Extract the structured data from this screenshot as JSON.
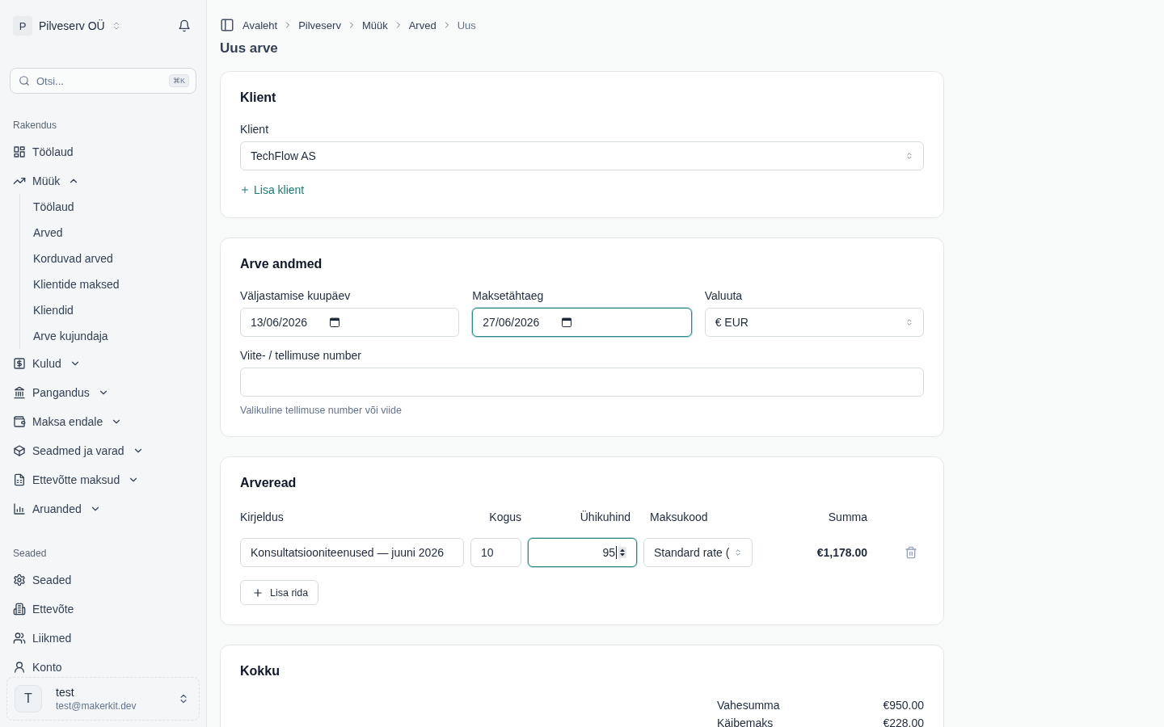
{
  "sidebar": {
    "org": {
      "initial": "P",
      "name": "Pilveserv OÜ"
    },
    "search": {
      "placeholder": "Otsi...",
      "shortcut": "⌘K"
    },
    "sections": [
      {
        "label": "Rakendus",
        "items": [
          {
            "label": "Töölaud",
            "kind": "link"
          },
          {
            "label": "Müük",
            "kind": "group",
            "expanded": true,
            "children": [
              {
                "label": "Töölaud"
              },
              {
                "label": "Arved"
              },
              {
                "label": "Korduvad arved"
              },
              {
                "label": "Klientide maksed"
              },
              {
                "label": "Kliendid"
              },
              {
                "label": "Arve kujundaja"
              }
            ]
          },
          {
            "label": "Kulud",
            "kind": "group",
            "expanded": false
          },
          {
            "label": "Pangandus",
            "kind": "group",
            "expanded": false
          },
          {
            "label": "Maksa endale",
            "kind": "group",
            "expanded": false
          },
          {
            "label": "Seadmed ja varad",
            "kind": "group",
            "expanded": false
          },
          {
            "label": "Ettevõtte maksud",
            "kind": "group",
            "expanded": false
          },
          {
            "label": "Aruanded",
            "kind": "group",
            "expanded": false
          }
        ]
      },
      {
        "label": "Seaded",
        "items": [
          {
            "label": "Seaded",
            "kind": "link"
          },
          {
            "label": "Ettevõte",
            "kind": "link"
          },
          {
            "label": "Liikmed",
            "kind": "link"
          },
          {
            "label": "Konto",
            "kind": "link"
          }
        ]
      }
    ],
    "user": {
      "initial": "T",
      "name": "test",
      "email": "test@makerkit.dev"
    }
  },
  "breadcrumb": [
    {
      "label": "Avaleht",
      "current": false
    },
    {
      "label": "Pilveserv",
      "current": false
    },
    {
      "label": "Müük",
      "current": false
    },
    {
      "label": "Arved",
      "current": false
    },
    {
      "label": "Uus",
      "current": true
    }
  ],
  "page_title": "Uus arve",
  "client_card": {
    "title": "Klient",
    "field": {
      "label": "Klient",
      "value": "TechFlow AS",
      "focused": false
    },
    "add_link": "Lisa klient"
  },
  "details_card": {
    "title": "Arve andmed",
    "fields": [
      {
        "label": "Väljastamise kuupäev",
        "kind": "date",
        "value": "13/06/2026",
        "focused": false
      },
      {
        "label": "Maksetähtaeg",
        "kind": "date",
        "value": "27/06/2026",
        "focused": true
      },
      {
        "label": "Valuuta",
        "kind": "select",
        "value": "€ EUR",
        "focused": false
      }
    ],
    "reference": {
      "label": "Viite- / tellimuse number",
      "hint": "Valikuline tellimuse number või viide",
      "focused": false
    }
  },
  "lines_card": {
    "title": "Arveread",
    "columns": [
      "Kirjeldus",
      "Kogus",
      "Ühikuhind",
      "Maksukood",
      "Summa"
    ],
    "rows": [
      {
        "description": {
          "value": "Konsultatsiooniteenused — juuni 2026",
          "focused": false
        },
        "quantity": {
          "value": "10",
          "focused": false
        },
        "unit_price": {
          "value": "95",
          "focused": true
        },
        "tax_code": {
          "value": "Standard rate (",
          "focused": false
        },
        "amount": "€1,178.00"
      }
    ],
    "add_button": "Lisa rida"
  },
  "totals_card": {
    "title": "Kokku",
    "rows": [
      {
        "label": "Vahesumma",
        "value": "€950.00"
      },
      {
        "label": "Käibemaks",
        "value": "€228.00"
      }
    ]
  }
}
